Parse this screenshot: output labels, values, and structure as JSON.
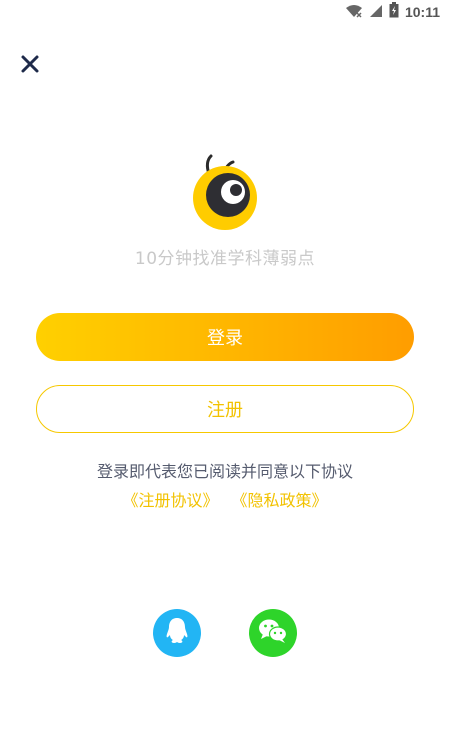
{
  "status_bar": {
    "time": "10:11",
    "icons": [
      "wifi-icon",
      "signal-icon",
      "battery-icon"
    ]
  },
  "header": {
    "close_icon": "close-icon"
  },
  "brand": {
    "logo_icon": "bee-logo-icon",
    "tagline": "10分钟找准学科薄弱点"
  },
  "actions": {
    "login_label": "登录",
    "register_label": "注册"
  },
  "agreement": {
    "text": "登录即代表您已阅读并同意以下协议",
    "register_agreement": "《注册协议》",
    "privacy_policy": "《隐私政策》"
  },
  "social_login": {
    "qq_icon": "qq-icon",
    "wechat_icon": "wechat-icon"
  },
  "colors": {
    "accent": "#FFB400",
    "accent_light": "#FFD000",
    "accent_dark": "#FF9D00",
    "qq": "#22B5F4",
    "wechat": "#2ED42A",
    "close_icon": "#1E2A4A"
  }
}
